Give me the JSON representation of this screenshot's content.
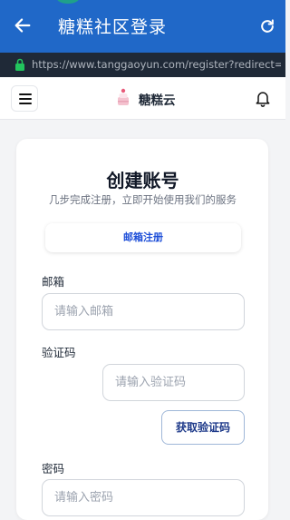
{
  "appbar": {
    "title": "糖糕社区登录"
  },
  "urlbar": {
    "url": "https://www.tanggaoyun.com/register?redirect=..."
  },
  "site": {
    "name": "糖糕云"
  },
  "form": {
    "title": "创建账号",
    "subtitle": "几步完成注册，立即开始使用我们的服务",
    "tab_label": "邮箱注册",
    "email_label": "邮箱",
    "email_placeholder": "请输入邮箱",
    "code_label": "验证码",
    "code_placeholder": "请输入验证码",
    "get_code_label": "获取验证码",
    "password_label": "密码",
    "password_placeholder": "请输入密码"
  },
  "colors": {
    "appbar": "#2068c8",
    "urlbar": "#1f2937",
    "accent": "#1d4ed8"
  }
}
